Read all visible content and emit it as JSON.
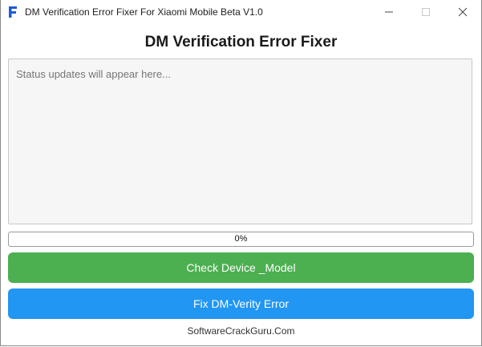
{
  "window": {
    "title": "DM Verification Error Fixer For Xiaomi Mobile Beta V1.0",
    "icon": "app-f-icon",
    "controls": [
      "minimize-icon",
      "maximize-icon",
      "close-icon"
    ]
  },
  "main": {
    "heading": "DM Verification Error Fixer",
    "status_placeholder": "Status updates will appear here...",
    "progress": {
      "value": 0,
      "label": "0%"
    },
    "check_button_label": "Check Device _Model",
    "fix_button_label": "Fix DM-Verity Error",
    "footer": "SoftwareCrackGuru.Com"
  },
  "colors": {
    "check_button": "#4caf50",
    "fix_button": "#2196f3",
    "app_icon": "#1e5bd8"
  }
}
